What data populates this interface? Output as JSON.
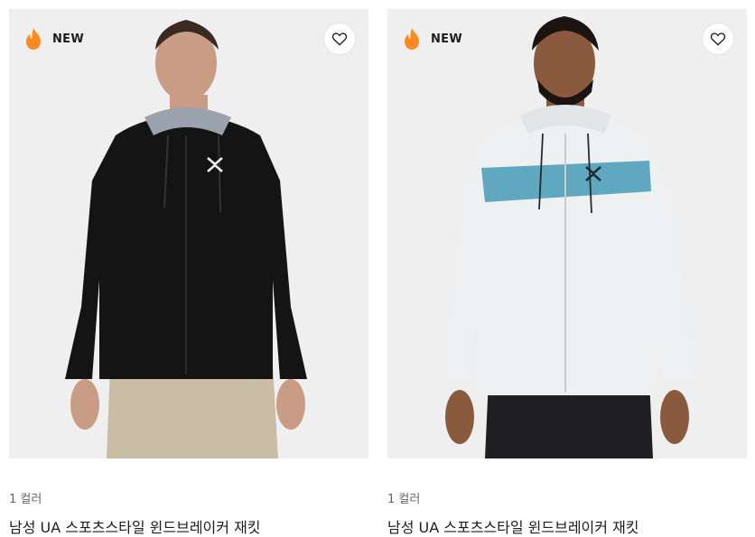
{
  "products": [
    {
      "badge": "NEW",
      "colors": "1 컬러",
      "name": "남성 UA 스포츠스타일 윈드브레이커 재킷",
      "icons": {
        "badge": "flame-icon",
        "favorite": "heart-outline-icon"
      }
    },
    {
      "badge": "NEW",
      "colors": "1 컬러",
      "name": "남성 UA 스포츠스타일 윈드브레이커 재킷",
      "icons": {
        "badge": "flame-icon",
        "favorite": "heart-outline-icon"
      }
    }
  ],
  "colors": {
    "badge_flame": "#ff8a1f",
    "image_bg": "#efefef",
    "jacket_black": "#141414",
    "jacket_white": "#eef0f2",
    "stripe_teal": "#5fa8bf"
  }
}
